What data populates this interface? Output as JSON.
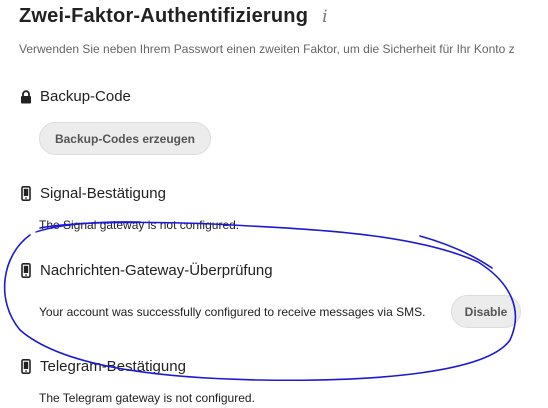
{
  "header": {
    "title": "Zwei-Faktor-Authentifizierung",
    "info_icon": "i",
    "subtitle": "Verwenden Sie neben Ihrem Passwort einen zweiten Faktor, um die Sicherheit für Ihr Konto z"
  },
  "sections": {
    "backup": {
      "icon": "lock-icon",
      "title": "Backup-Code",
      "button_label": "Backup-Codes erzeugen"
    },
    "signal": {
      "icon": "phone-icon",
      "title": "Signal-Bestätigung",
      "text": "The Signal gateway is not configured."
    },
    "sms": {
      "icon": "phone-icon",
      "title": "Nachrichten-Gateway-Überprüfung",
      "text": "Your account was successfully configured to receive messages via SMS.",
      "button_label": "Disable"
    },
    "telegram": {
      "icon": "phone-icon",
      "title": "Telegram-Bestätigung",
      "text": "The Telegram gateway is not configured."
    }
  },
  "colors": {
    "annotation_stroke": "#1a1ad6",
    "button_bg": "#ececec",
    "subtitle_text": "#666666"
  }
}
